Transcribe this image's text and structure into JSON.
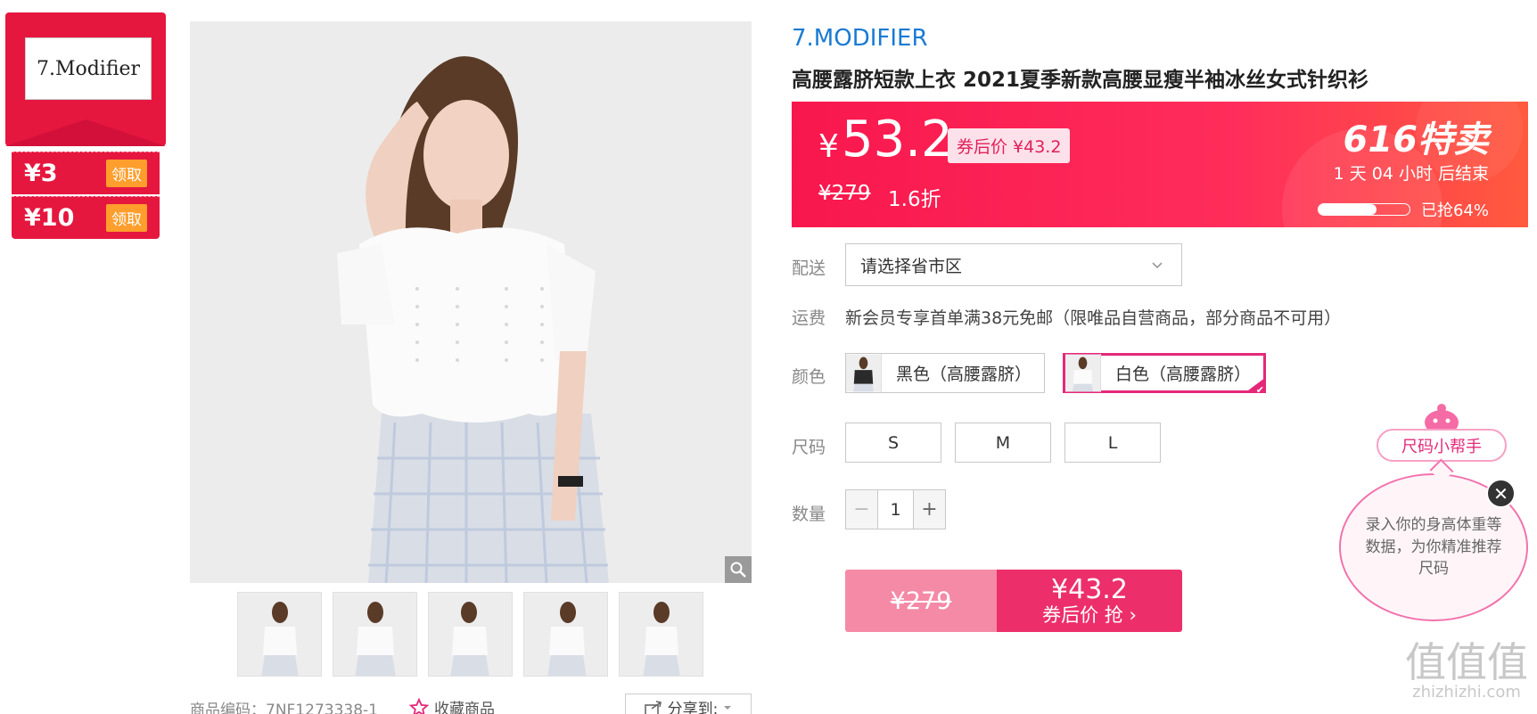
{
  "store": {
    "logo_text": "7.Modifier",
    "coupons": [
      {
        "amount": "¥3",
        "button": "领取"
      },
      {
        "amount": "¥10",
        "button": "领取"
      }
    ]
  },
  "product": {
    "brand": "7.MODIFIER",
    "title": "高腰露脐短款上衣 2021夏季新款高腰显瘦半袖冰丝女式针织衫",
    "code_label": "商品编码：7NF1273338-1",
    "favorite_label": "收藏商品",
    "share_label": "分享到:"
  },
  "price": {
    "currency": "¥",
    "current": "53.2",
    "coupon_price": "券后价 ¥43.2",
    "original": "¥279",
    "discount": "1.6折",
    "promo_title": "616特卖",
    "countdown": "1 天 04 小时 后结束",
    "progress_text": "已抢64%",
    "progress_fraction": 0.64
  },
  "options": {
    "delivery_label": "配送",
    "delivery_placeholder": "请选择省市区",
    "shipping_label": "运费",
    "shipping_text": "新会员专享首单满38元免邮（限唯品自营商品，部分商品不可用）",
    "color_label": "颜色",
    "colors": [
      {
        "name": "黑色（高腰露脐）",
        "selected": false,
        "swatch": "#2a2a2a"
      },
      {
        "name": "白色（高腰露脐）",
        "selected": true,
        "swatch": "#f0f0f0"
      }
    ],
    "size_label": "尺码",
    "sizes": [
      "S",
      "M",
      "L"
    ],
    "quantity_label": "数量",
    "quantity": "1"
  },
  "buy": {
    "original": "¥279",
    "price": "¥43.2",
    "cta": "券后价 抢 ›"
  },
  "size_helper": {
    "button": "尺码小帮手",
    "message": "录入你的身高体重等数据，为你精准推荐尺码",
    "close": "✕"
  },
  "watermark": {
    "big": "值值值",
    "small": "zhizhizhi.com"
  },
  "colors": {
    "accent": "#e5173f",
    "brand_link": "#1a7ad4",
    "selected_border": "#e5287a"
  }
}
